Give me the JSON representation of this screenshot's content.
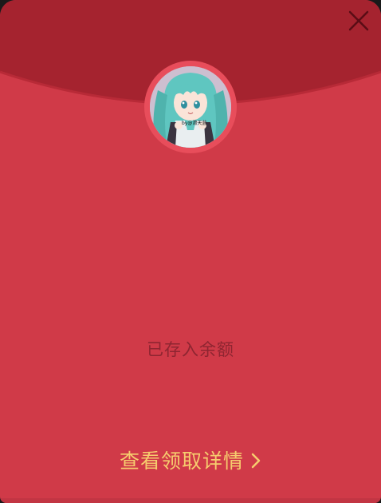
{
  "envelope": {
    "status_text": "已存入余额",
    "details_link_label": "查看领取详情",
    "details_link_icon": "chevron-right-icon",
    "close_icon": "close-icon",
    "avatar_alt": "anime character avatar",
    "avatar_watermark": "by@滑天蓝"
  },
  "colors": {
    "envelope_body": "#d03a48",
    "flap": "#a5232f",
    "status_text": "#8e2531",
    "link_text": "#f6cc6e",
    "avatar_ring": "#e84d5b"
  }
}
